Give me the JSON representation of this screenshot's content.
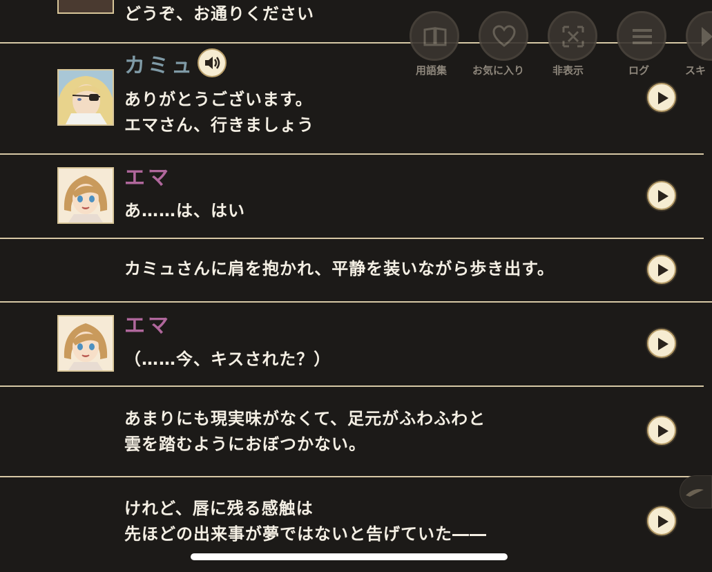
{
  "top_partial": {
    "text": "どうぞ、お通りください"
  },
  "toolbar": {
    "glossary_label": "用語集",
    "favorite_label": "お気に入り",
    "hide_label": "非表示",
    "log_label": "ログ",
    "skip_label": "スキ"
  },
  "entries": [
    {
      "speaker": "カミュ",
      "speaker_color": "#7f9aa6",
      "text": "ありがとうございます。\nエマさん、行きましょう"
    },
    {
      "speaker": "エマ",
      "speaker_color": "#b0679c",
      "text": "あ……は、はい"
    },
    {
      "speaker": "",
      "text": "カミュさんに肩を抱かれ、平静を装いながら歩き出す。"
    },
    {
      "speaker": "エマ",
      "speaker_color": "#b0679c",
      "text": "（……今、キスされた？）"
    },
    {
      "speaker": "",
      "text": "あまりにも現実味がなくて、足元がふわふわと\n雲を踏むようにおぼつかない。"
    },
    {
      "speaker": "",
      "text": "けれど、唇に残る感触は\n先ほどの出来事が夢ではないと告げていた――"
    }
  ],
  "colors": {
    "background": "#1c1a18",
    "divider": "#d8c9a6",
    "text": "#f4efe4",
    "button_fill": "#f6ecd2"
  }
}
